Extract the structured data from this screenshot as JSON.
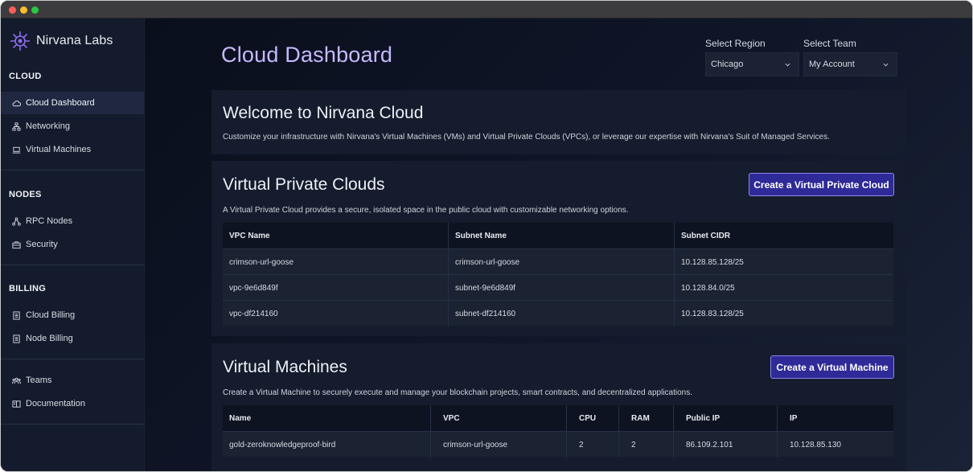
{
  "app": {
    "brand": "Nirvana Labs"
  },
  "sidebar": {
    "sections": [
      {
        "title": "CLOUD",
        "items": [
          {
            "label": "Cloud Dashboard",
            "icon": "cloud-icon",
            "active": true
          },
          {
            "label": "Networking",
            "icon": "network-icon"
          },
          {
            "label": "Virtual Machines",
            "icon": "laptop-icon"
          }
        ]
      },
      {
        "title": "NODES",
        "items": [
          {
            "label": "RPC Nodes",
            "icon": "nodes-icon"
          },
          {
            "label": "Security",
            "icon": "briefcase-icon"
          }
        ]
      },
      {
        "title": "BILLING",
        "items": [
          {
            "label": "Cloud Billing",
            "icon": "receipt-icon"
          },
          {
            "label": "Node Billing",
            "icon": "receipt-icon"
          }
        ]
      },
      {
        "title": "",
        "items": [
          {
            "label": "Teams",
            "icon": "team-icon"
          },
          {
            "label": "Documentation",
            "icon": "book-icon"
          }
        ]
      }
    ]
  },
  "header": {
    "title": "Cloud Dashboard",
    "region_label": "Select Region",
    "region_value": "Chicago",
    "team_label": "Select Team",
    "team_value": "My Account"
  },
  "welcome": {
    "title": "Welcome to Nirvana Cloud",
    "description": "Customize your infrastructure with Nirvana's Virtual Machines (VMs) and Virtual Private Clouds (VPCs), or leverage our expertise with Nirvana's Suit of Managed Services."
  },
  "vpcs": {
    "title": "Virtual Private Clouds",
    "button": "Create a Virtual Private Cloud",
    "description": "A Virtual Private Cloud provides a secure, isolated space in the public cloud with customizable networking options.",
    "columns": [
      "VPC Name",
      "Subnet Name",
      "Subnet CIDR"
    ],
    "rows": [
      [
        "crimson-url-goose",
        "crimson-url-goose",
        "10.128.85.128/25"
      ],
      [
        "vpc-9e6d849f",
        "subnet-9e6d849f",
        "10.128.84.0/25"
      ],
      [
        "vpc-df214160",
        "subnet-df214160",
        "10.128.83.128/25"
      ]
    ]
  },
  "vms": {
    "title": "Virtual Machines",
    "button": "Create a Virtual Machine",
    "description": "Create a Virtual Machine to securely execute and manage your blockchain projects, smart contracts, and decentralized applications.",
    "columns": [
      "Name",
      "VPC",
      "CPU",
      "RAM",
      "Public IP",
      "IP"
    ],
    "rows": [
      [
        "gold-zeroknowledgeproof-bird",
        "crimson-url-goose",
        "2",
        "2",
        "86.109.2.101",
        "10.128.85.130"
      ]
    ]
  },
  "colors": {
    "accent": "#c6b9ff",
    "button": "#2e2a98",
    "button_border": "#8b86f0",
    "active_nav": "#1f2840"
  }
}
